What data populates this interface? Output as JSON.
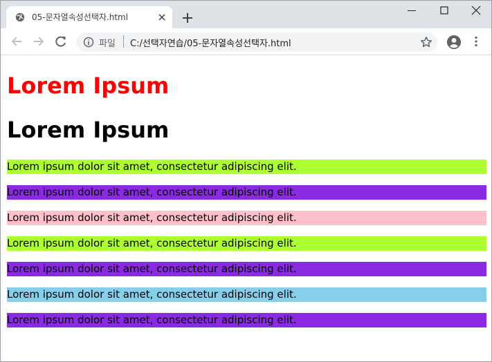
{
  "browser": {
    "tab_title": "05-문자열속성선택자.html",
    "url_scheme": "파일",
    "url": "C:/선택자연습/05-문자열속성선택자.html"
  },
  "page": {
    "heading1": "Lorem Ipsum",
    "heading2": "Lorem Ipsum",
    "paragraphs": [
      {
        "text": "Lorem ipsum dolor sit amet, consectetur adipiscing elit.",
        "bg": "#adff2f"
      },
      {
        "text": "Lorem ipsum dolor sit amet, consectetur adipiscing elit.",
        "bg": "#8a2be2"
      },
      {
        "text": "Lorem ipsum dolor sit amet, consectetur adipiscing elit.",
        "bg": "#ffc0cb"
      },
      {
        "text": "Lorem ipsum dolor sit amet, consectetur adipiscing elit.",
        "bg": "#adff2f"
      },
      {
        "text": "Lorem ipsum dolor sit amet, consectetur adipiscing elit.",
        "bg": "#8a2be2"
      },
      {
        "text": "Lorem ipsum dolor sit amet, consectetur adipiscing elit.",
        "bg": "#87ceeb"
      },
      {
        "text": "Lorem ipsum dolor sit amet, consectetur adipiscing elit.",
        "bg": "#8a2be2"
      }
    ]
  },
  "colors": {
    "heading_red": "#ff0000",
    "tabstrip_bg": "#dee1e6",
    "omnibox_bg": "#f1f3f4"
  },
  "icons": [
    "globe-icon",
    "close-icon",
    "plus-icon",
    "minimize-icon",
    "maximize-icon",
    "back-arrow-icon",
    "forward-arrow-icon",
    "reload-icon",
    "info-icon",
    "star-icon",
    "profile-icon",
    "kebab-menu-icon"
  ]
}
